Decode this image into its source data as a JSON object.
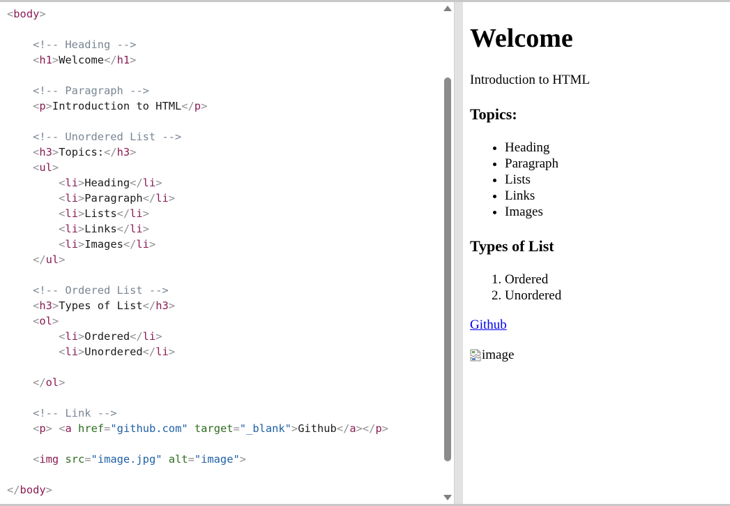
{
  "editor": {
    "lines": [
      [
        {
          "t": "br",
          "v": "<"
        },
        {
          "t": "tag",
          "v": "body"
        },
        {
          "t": "br",
          "v": ">"
        }
      ],
      [],
      [
        {
          "t": "ws",
          "v": "    "
        },
        {
          "t": "com",
          "v": "<!-- Heading -->"
        }
      ],
      [
        {
          "t": "ws",
          "v": "    "
        },
        {
          "t": "br",
          "v": "<"
        },
        {
          "t": "tag",
          "v": "h1"
        },
        {
          "t": "br",
          "v": ">"
        },
        {
          "t": "txt",
          "v": "Welcome"
        },
        {
          "t": "br",
          "v": "</"
        },
        {
          "t": "tag",
          "v": "h1"
        },
        {
          "t": "br",
          "v": ">"
        }
      ],
      [],
      [
        {
          "t": "ws",
          "v": "    "
        },
        {
          "t": "com",
          "v": "<!-- Paragraph -->"
        }
      ],
      [
        {
          "t": "ws",
          "v": "    "
        },
        {
          "t": "br",
          "v": "<"
        },
        {
          "t": "tag",
          "v": "p"
        },
        {
          "t": "br",
          "v": ">"
        },
        {
          "t": "txt",
          "v": "Introduction to HTML"
        },
        {
          "t": "br",
          "v": "</"
        },
        {
          "t": "tag",
          "v": "p"
        },
        {
          "t": "br",
          "v": ">"
        }
      ],
      [],
      [
        {
          "t": "ws",
          "v": "    "
        },
        {
          "t": "com",
          "v": "<!-- Unordered List -->"
        }
      ],
      [
        {
          "t": "ws",
          "v": "    "
        },
        {
          "t": "br",
          "v": "<"
        },
        {
          "t": "tag",
          "v": "h3"
        },
        {
          "t": "br",
          "v": ">"
        },
        {
          "t": "txt",
          "v": "Topics:"
        },
        {
          "t": "br",
          "v": "</"
        },
        {
          "t": "tag",
          "v": "h3"
        },
        {
          "t": "br",
          "v": ">"
        }
      ],
      [
        {
          "t": "ws",
          "v": "    "
        },
        {
          "t": "br",
          "v": "<"
        },
        {
          "t": "tag",
          "v": "ul"
        },
        {
          "t": "br",
          "v": ">"
        }
      ],
      [
        {
          "t": "ws",
          "v": "        "
        },
        {
          "t": "br",
          "v": "<"
        },
        {
          "t": "tag",
          "v": "li"
        },
        {
          "t": "br",
          "v": ">"
        },
        {
          "t": "txt",
          "v": "Heading"
        },
        {
          "t": "br",
          "v": "</"
        },
        {
          "t": "tag",
          "v": "li"
        },
        {
          "t": "br",
          "v": ">"
        }
      ],
      [
        {
          "t": "ws",
          "v": "        "
        },
        {
          "t": "br",
          "v": "<"
        },
        {
          "t": "tag",
          "v": "li"
        },
        {
          "t": "br",
          "v": ">"
        },
        {
          "t": "txt",
          "v": "Paragraph"
        },
        {
          "t": "br",
          "v": "</"
        },
        {
          "t": "tag",
          "v": "li"
        },
        {
          "t": "br",
          "v": ">"
        }
      ],
      [
        {
          "t": "ws",
          "v": "        "
        },
        {
          "t": "br",
          "v": "<"
        },
        {
          "t": "tag",
          "v": "li"
        },
        {
          "t": "br",
          "v": ">"
        },
        {
          "t": "txt",
          "v": "Lists"
        },
        {
          "t": "br",
          "v": "</"
        },
        {
          "t": "tag",
          "v": "li"
        },
        {
          "t": "br",
          "v": ">"
        }
      ],
      [
        {
          "t": "ws",
          "v": "        "
        },
        {
          "t": "br",
          "v": "<"
        },
        {
          "t": "tag",
          "v": "li"
        },
        {
          "t": "br",
          "v": ">"
        },
        {
          "t": "txt",
          "v": "Links"
        },
        {
          "t": "br",
          "v": "</"
        },
        {
          "t": "tag",
          "v": "li"
        },
        {
          "t": "br",
          "v": ">"
        }
      ],
      [
        {
          "t": "ws",
          "v": "        "
        },
        {
          "t": "br",
          "v": "<"
        },
        {
          "t": "tag",
          "v": "li"
        },
        {
          "t": "br",
          "v": ">"
        },
        {
          "t": "txt",
          "v": "Images"
        },
        {
          "t": "br",
          "v": "</"
        },
        {
          "t": "tag",
          "v": "li"
        },
        {
          "t": "br",
          "v": ">"
        }
      ],
      [
        {
          "t": "ws",
          "v": "    "
        },
        {
          "t": "br",
          "v": "</"
        },
        {
          "t": "tag",
          "v": "ul"
        },
        {
          "t": "br",
          "v": ">"
        }
      ],
      [],
      [
        {
          "t": "ws",
          "v": "    "
        },
        {
          "t": "com",
          "v": "<!-- Ordered List -->"
        }
      ],
      [
        {
          "t": "ws",
          "v": "    "
        },
        {
          "t": "br",
          "v": "<"
        },
        {
          "t": "tag",
          "v": "h3"
        },
        {
          "t": "br",
          "v": ">"
        },
        {
          "t": "txt",
          "v": "Types of List"
        },
        {
          "t": "br",
          "v": "</"
        },
        {
          "t": "tag",
          "v": "h3"
        },
        {
          "t": "br",
          "v": ">"
        }
      ],
      [
        {
          "t": "ws",
          "v": "    "
        },
        {
          "t": "br",
          "v": "<"
        },
        {
          "t": "tag",
          "v": "ol"
        },
        {
          "t": "br",
          "v": ">"
        }
      ],
      [
        {
          "t": "ws",
          "v": "        "
        },
        {
          "t": "br",
          "v": "<"
        },
        {
          "t": "tag",
          "v": "li"
        },
        {
          "t": "br",
          "v": ">"
        },
        {
          "t": "txt",
          "v": "Ordered"
        },
        {
          "t": "br",
          "v": "</"
        },
        {
          "t": "tag",
          "v": "li"
        },
        {
          "t": "br",
          "v": ">"
        }
      ],
      [
        {
          "t": "ws",
          "v": "        "
        },
        {
          "t": "br",
          "v": "<"
        },
        {
          "t": "tag",
          "v": "li"
        },
        {
          "t": "br",
          "v": ">"
        },
        {
          "t": "txt",
          "v": "Unordered"
        },
        {
          "t": "br",
          "v": "</"
        },
        {
          "t": "tag",
          "v": "li"
        },
        {
          "t": "br",
          "v": ">"
        }
      ],
      [],
      [
        {
          "t": "ws",
          "v": "    "
        },
        {
          "t": "br",
          "v": "</"
        },
        {
          "t": "tag",
          "v": "ol"
        },
        {
          "t": "br",
          "v": ">"
        }
      ],
      [],
      [
        {
          "t": "ws",
          "v": "    "
        },
        {
          "t": "com",
          "v": "<!-- Link -->"
        }
      ],
      [
        {
          "t": "ws",
          "v": "    "
        },
        {
          "t": "br",
          "v": "<"
        },
        {
          "t": "tag",
          "v": "p"
        },
        {
          "t": "br",
          "v": ">"
        },
        {
          "t": "ws",
          "v": " "
        },
        {
          "t": "br",
          "v": "<"
        },
        {
          "t": "tag",
          "v": "a"
        },
        {
          "t": "ws",
          "v": " "
        },
        {
          "t": "attr",
          "v": "href"
        },
        {
          "t": "br",
          "v": "="
        },
        {
          "t": "val",
          "v": "\"github.com\""
        },
        {
          "t": "ws",
          "v": " "
        },
        {
          "t": "attr",
          "v": "target"
        },
        {
          "t": "br",
          "v": "="
        },
        {
          "t": "val",
          "v": "\"_blank\""
        },
        {
          "t": "br",
          "v": ">"
        },
        {
          "t": "txt",
          "v": "Github"
        },
        {
          "t": "br",
          "v": "</"
        },
        {
          "t": "tag",
          "v": "a"
        },
        {
          "t": "br",
          "v": "></"
        },
        {
          "t": "tag",
          "v": "p"
        },
        {
          "t": "br",
          "v": ">"
        }
      ],
      [],
      [
        {
          "t": "ws",
          "v": "    "
        },
        {
          "t": "br",
          "v": "<"
        },
        {
          "t": "tag",
          "v": "img"
        },
        {
          "t": "ws",
          "v": " "
        },
        {
          "t": "attr",
          "v": "src"
        },
        {
          "t": "br",
          "v": "="
        },
        {
          "t": "val",
          "v": "\"image.jpg\""
        },
        {
          "t": "ws",
          "v": " "
        },
        {
          "t": "attr",
          "v": "alt"
        },
        {
          "t": "br",
          "v": "="
        },
        {
          "t": "val",
          "v": "\"image\""
        },
        {
          "t": "br",
          "v": ">"
        }
      ],
      [],
      [
        {
          "t": "br",
          "v": "</"
        },
        {
          "t": "tag",
          "v": "body"
        },
        {
          "t": "br",
          "v": ">"
        }
      ]
    ]
  },
  "preview": {
    "heading": "Welcome",
    "paragraph": "Introduction to HTML",
    "topics_heading": "Topics:",
    "topics": [
      "Heading",
      "Paragraph",
      "Lists",
      "Links",
      "Images"
    ],
    "types_heading": "Types of List",
    "types": [
      "Ordered",
      "Unordered"
    ],
    "link_text": "Github",
    "link_href": "github.com",
    "image_alt": "image"
  },
  "colors": {
    "tag": "#8a1b54",
    "bracket": "#8f8f8f",
    "attribute": "#2e6b1e",
    "value": "#1f5fa6",
    "comment": "#7a8694",
    "link": "#0000ee"
  },
  "icons": {
    "scroll_up": "triangle-up-icon",
    "scroll_down": "triangle-down-icon",
    "broken_image": "broken-image-icon"
  }
}
